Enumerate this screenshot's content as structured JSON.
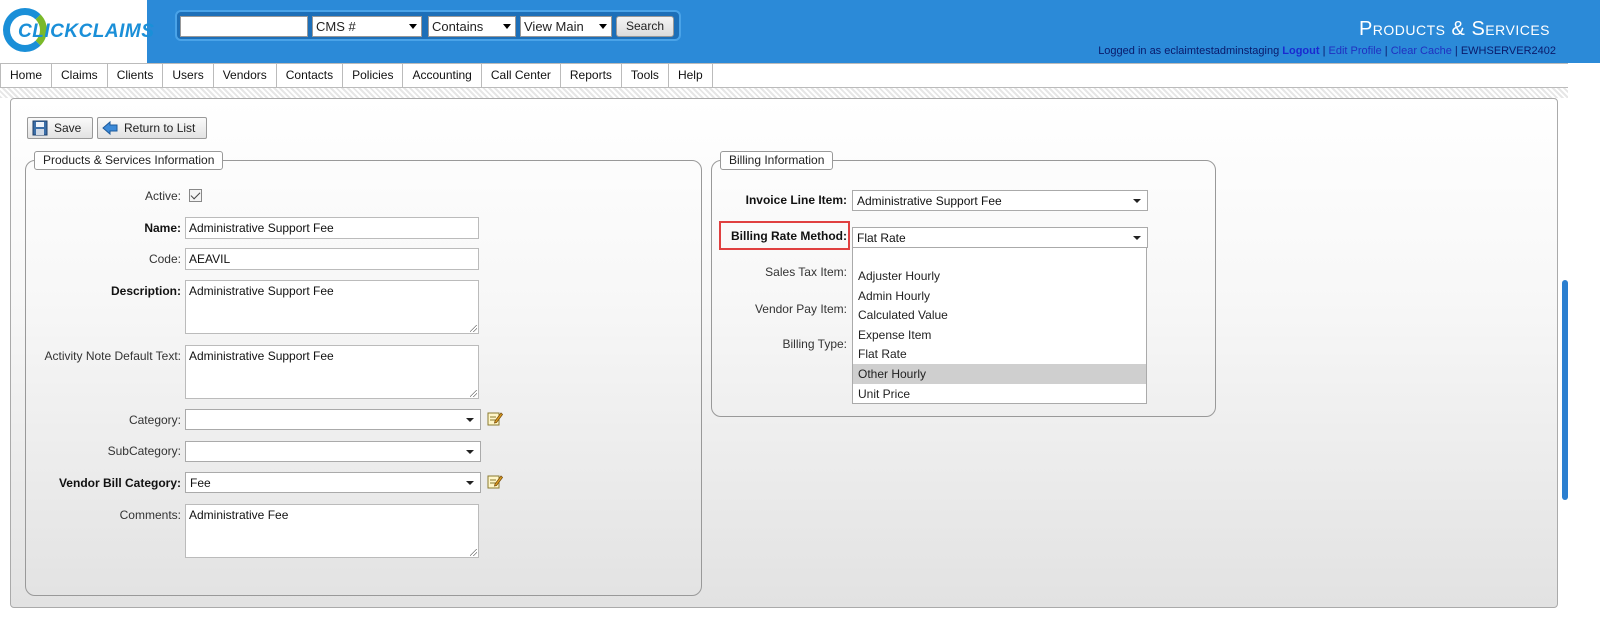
{
  "header": {
    "logo_text_click": "CLICK",
    "logo_text_claims": "CLAIMS",
    "page_title": "Products & Services",
    "search": {
      "input_value": "",
      "field_select": "CMS #",
      "operator_select": "Contains",
      "view_select": "View Main",
      "button": "Search"
    },
    "login": {
      "prefix": "Logged in as eclaimtestadminstaging",
      "logout": "Logout",
      "edit_profile": "Edit Profile",
      "clear_cache": "Clear Cache",
      "server": "EWHSERVER2402"
    }
  },
  "nav": [
    "Home",
    "Claims",
    "Clients",
    "Users",
    "Vendors",
    "Contacts",
    "Policies",
    "Accounting",
    "Call Center",
    "Reports",
    "Tools",
    "Help"
  ],
  "toolbar": {
    "save": "Save",
    "return": "Return to List"
  },
  "product_info": {
    "legend": "Products & Services Information",
    "active_label": "Active:",
    "name_label": "Name:",
    "name_value": "Administrative Support Fee",
    "code_label": "Code:",
    "code_value": "AEAVIL",
    "description_label": "Description:",
    "description_value": "Administrative Support Fee",
    "activity_label": "Activity Note Default Text:",
    "activity_value": "Administrative Support Fee",
    "category_label": "Category:",
    "category_value": "",
    "subcategory_label": "SubCategory:",
    "subcategory_value": "",
    "vendor_bill_label": "Vendor Bill Category:",
    "vendor_bill_value": "Fee",
    "comments_label": "Comments:",
    "comments_value": "Administrative Fee"
  },
  "billing_info": {
    "legend": "Billing Information",
    "invoice_label": "Invoice Line Item:",
    "invoice_value": "Administrative Support Fee",
    "rate_method_label": "Billing Rate Method:",
    "rate_method_value": "Flat Rate",
    "sales_tax_label": "Sales Tax Item:",
    "vendor_pay_label": "Vendor Pay Item:",
    "billing_type_label": "Billing Type:",
    "rate_method_options": [
      "",
      "Adjuster Hourly",
      "Admin Hourly",
      "Calculated Value",
      "Expense Item",
      "Flat Rate",
      "Other Hourly",
      "Unit Price"
    ],
    "hovered_option": "Other Hourly"
  },
  "colors": {
    "header_blue": "#2b8ad8",
    "highlight_red": "#e04040"
  }
}
